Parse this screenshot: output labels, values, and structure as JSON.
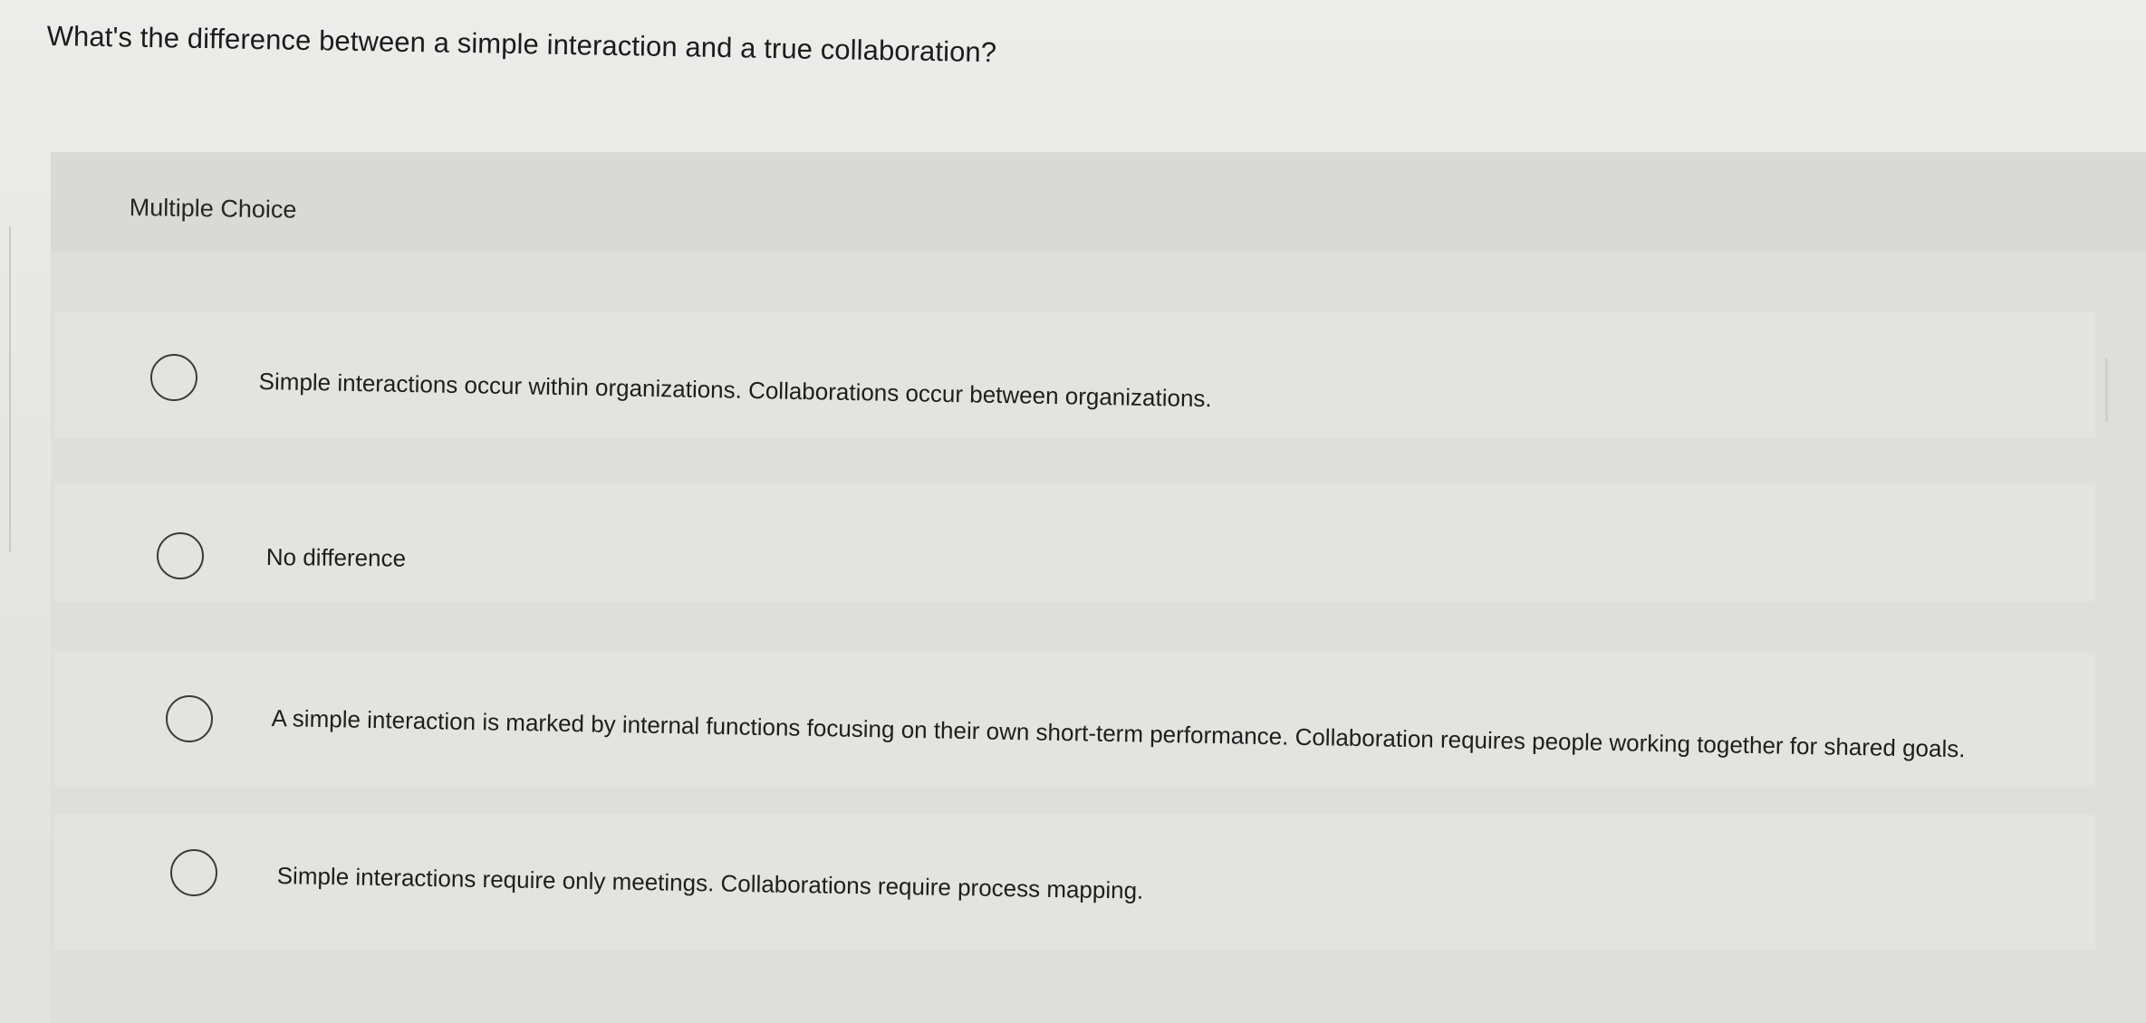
{
  "question": {
    "text": "What's the difference between a simple interaction and a true collaboration?"
  },
  "question_type": "Multiple Choice",
  "options": [
    {
      "label": "Simple interactions occur within organizations. Collaborations occur between organizations.",
      "selected": false
    },
    {
      "label": "No difference",
      "selected": false
    },
    {
      "label": "A simple interaction is marked by internal functions focusing on their own short-term performance. Collaboration requires people working together for shared goals.",
      "selected": false
    },
    {
      "label": "Simple interactions require only meetings. Collaborations require process mapping.",
      "selected": false
    }
  ],
  "icons": {
    "radio": "radio-unchecked-icon"
  }
}
